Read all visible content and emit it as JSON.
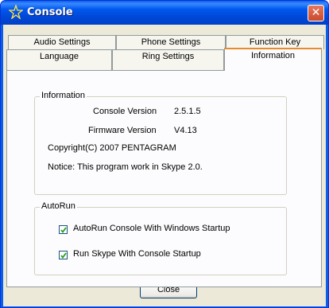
{
  "window": {
    "title": "Console",
    "app_icon": "star-icon",
    "close_glyph": "✕"
  },
  "tabs": {
    "row_back": [
      "Audio Settings",
      "Phone Settings",
      "Function Key"
    ],
    "row_front": [
      "Language",
      "Ring Settings",
      "Information"
    ],
    "active": "Information"
  },
  "information": {
    "group_label": "Information",
    "console_version_label": "Console Version",
    "console_version_value": "2.5.1.5",
    "firmware_version_label": "Firmware Version",
    "firmware_version_value": "V4.13",
    "copyright": "Copyright(C) 2007 PENTAGRAM",
    "notice": "Notice: This program work in Skype 2.0."
  },
  "autorun": {
    "group_label": "AutoRun",
    "option1_label": "AutoRun Console With Windows Startup",
    "option1_checked": true,
    "option2_label": "Run Skype With Console Startup",
    "option2_checked": true
  },
  "buttons": {
    "close": "Close"
  }
}
